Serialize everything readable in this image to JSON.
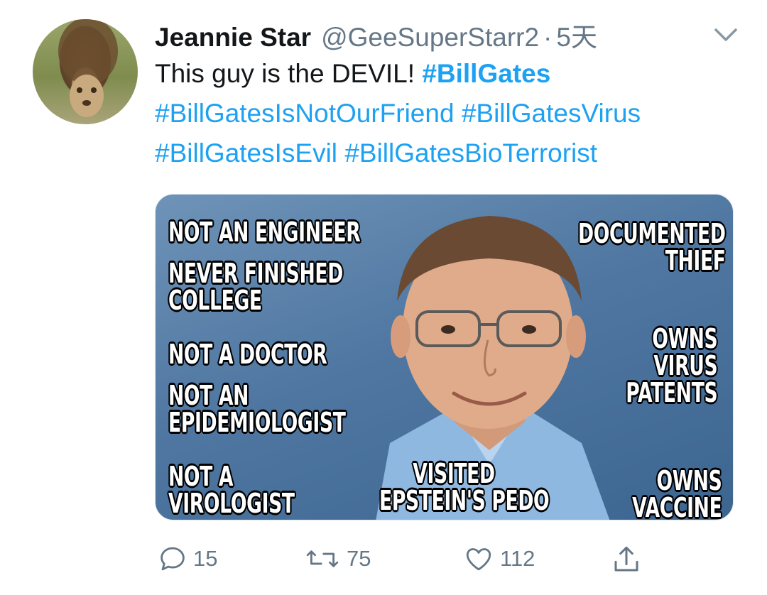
{
  "tweet": {
    "display_name": "Jeannie Star",
    "handle": "@GeeSuperStarr2",
    "separator": "·",
    "time": "5天",
    "text_plain": "This guy is the DEVIL! ",
    "hashtags": [
      "#BillGates",
      "#BillGatesIsNotOurFriend",
      "#BillGatesVirus",
      "#BillGatesIsEvil",
      "#BillGatesBioTerrorist"
    ]
  },
  "media": {
    "captions": {
      "not_engineer": "NOT AN ENGINEER",
      "never_finished": "NEVER FINISHED\nCOLLEGE",
      "not_doctor": "NOT A DOCTOR",
      "not_epidemiologist": "NOT AN\nEPIDEMIOLOGIST",
      "not_virologist": "NOT A\nVIROLOGIST",
      "documented_thief": "DOCUMENTED\nTHIEF",
      "owns_virus_patents": "OWNS\nVIRUS\nPATENTS",
      "owns_vaccine": "OWNS\nVACCINE",
      "visited_epstein": "VISITED\nEPSTEIN'S PEDO"
    }
  },
  "actions": {
    "reply_count": "15",
    "retweet_count": "75",
    "like_count": "112"
  },
  "icons": {
    "menu": "chevron-down-icon",
    "reply": "reply-icon",
    "retweet": "retweet-icon",
    "like": "heart-icon",
    "share": "share-icon"
  },
  "colors": {
    "link": "#1da1f2",
    "secondary": "#657786",
    "text": "#14171a"
  }
}
